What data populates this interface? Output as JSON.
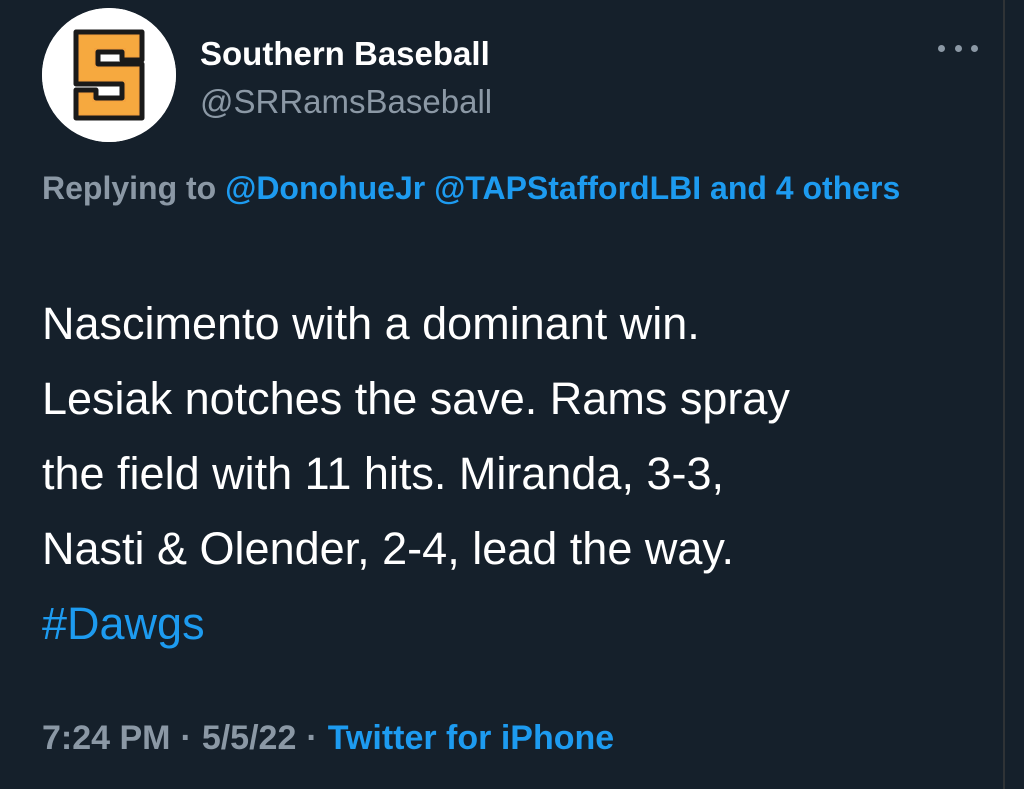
{
  "author": {
    "display_name": "Southern Baseball",
    "handle": "@SRRamsBaseball",
    "avatar_icon": "orange-s-logo-icon"
  },
  "reply": {
    "prefix": "Replying to",
    "mentions": [
      "@DonohueJr",
      "@TAPStaffordLBI",
      "and 4 others"
    ]
  },
  "tweet": {
    "lines": [
      "Nascimento with a dominant win.",
      "Lesiak notches the save. Rams spray",
      "the field with 11 hits. Miranda, 3-3,",
      "Nasti & Olender, 2-4, lead the way."
    ],
    "hashtag": "#Dawgs"
  },
  "meta": {
    "time": "7:24 PM",
    "date": "5/5/22",
    "separator": "·",
    "source": "Twitter for iPhone"
  },
  "colors": {
    "background": "#15202b",
    "accent": "#1d9bf0",
    "secondary_text": "#8b98a5",
    "logo_orange": "#f5a33d"
  }
}
